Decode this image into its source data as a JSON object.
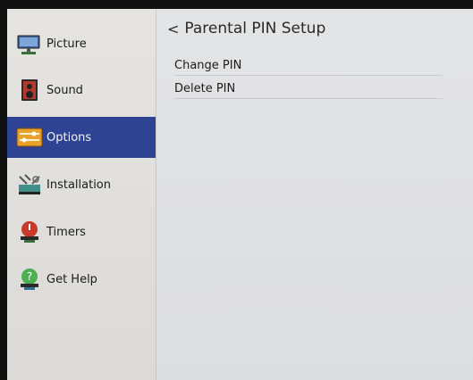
{
  "sidebar": {
    "items": [
      {
        "label": "Picture",
        "icon": "monitor-icon"
      },
      {
        "label": "Sound",
        "icon": "speaker-icon"
      },
      {
        "label": "Options",
        "icon": "options-panel-icon",
        "active": true
      },
      {
        "label": "Installation",
        "icon": "installation-tools-icon"
      },
      {
        "label": "Timers",
        "icon": "timer-alarm-icon"
      },
      {
        "label": "Get Help",
        "icon": "help-icon"
      }
    ]
  },
  "main": {
    "back_glyph": "<",
    "title": "Parental PIN Setup",
    "options": [
      {
        "label": "Change PIN"
      },
      {
        "label": "Delete  PIN"
      }
    ]
  },
  "colors": {
    "active_bg": "#2f4394",
    "sidebar_bg": "#e6e4e1",
    "main_bg": "#e3e4e6"
  }
}
